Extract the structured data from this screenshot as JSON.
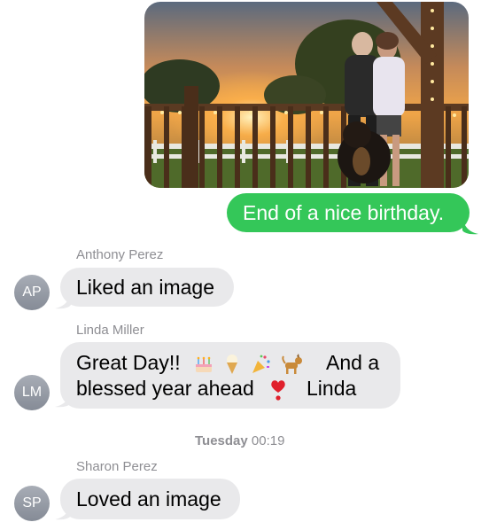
{
  "conversation": {
    "messages": [
      {
        "type": "sent",
        "image": "birthday-photo",
        "text": "End of a nice birthday.",
        "bubble_color": "#34c759"
      },
      {
        "type": "received",
        "sender": "Anthony Perez",
        "initials": "AP",
        "text": "Liked an image",
        "bubble_color": "#e9e9eb"
      },
      {
        "type": "received",
        "sender": "Linda Miller",
        "initials": "LM",
        "line1_a": "Great Day!!",
        "line1_b": "And a",
        "line2_a": "blessed year ahead",
        "line2_b": "Linda",
        "emojis": [
          "cake-icon",
          "ice-cream-icon",
          "party-popper-icon",
          "dog-icon",
          "heart-icon"
        ]
      },
      {
        "type": "timestamp",
        "day": "Tuesday",
        "time": "00:19"
      },
      {
        "type": "received",
        "sender": "Sharon Perez",
        "initials": "SP",
        "text": "Loved an image",
        "bubble_color": "#e9e9eb"
      }
    ]
  }
}
